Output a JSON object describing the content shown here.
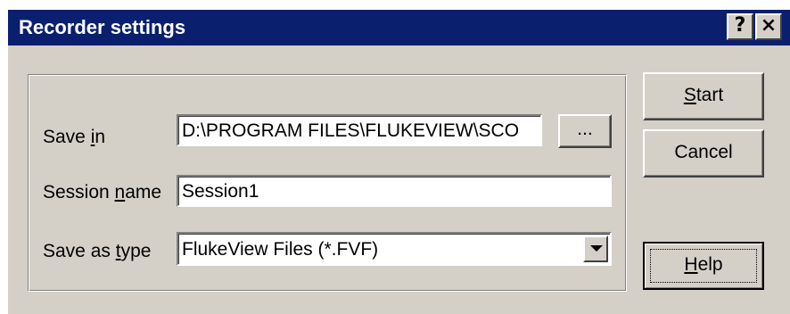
{
  "window": {
    "title": "Recorder settings",
    "help_icon": "?",
    "close_icon": "×"
  },
  "form": {
    "save_in": {
      "label_prefix": "Save ",
      "label_mnemonic": "i",
      "label_suffix": "n",
      "value": "D:\\PROGRAM FILES\\FLUKEVIEW\\SCO",
      "browse_label": "..."
    },
    "session_name": {
      "label_prefix": "Session ",
      "label_mnemonic": "n",
      "label_suffix": "ame",
      "value": "Session1"
    },
    "save_as_type": {
      "label_prefix": "Save as ",
      "label_mnemonic": "t",
      "label_suffix": "ype",
      "value": "FlukeView Files (*.FVF)"
    }
  },
  "buttons": {
    "start": {
      "mnemonic": "S",
      "rest": "tart"
    },
    "cancel": {
      "label": "Cancel"
    },
    "help": {
      "mnemonic": "H",
      "rest": "elp"
    }
  },
  "colors": {
    "titlebar": "#0a1f6e",
    "face": "#d4d0c8"
  }
}
